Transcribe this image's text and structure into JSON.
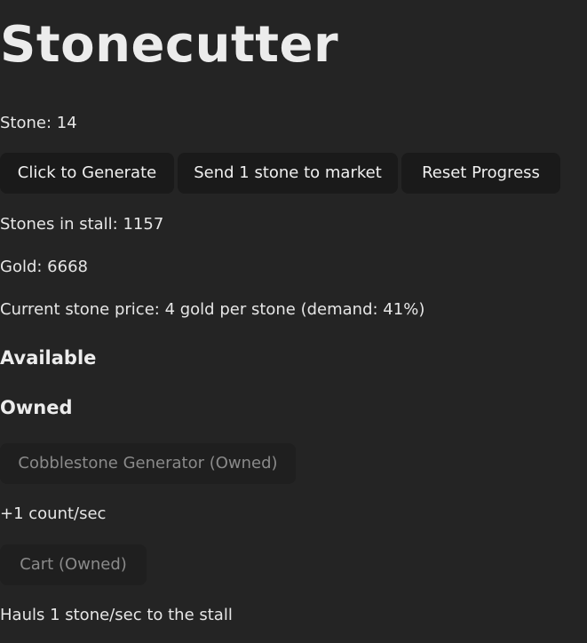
{
  "title": "Stonecutter",
  "stone_line": "Stone: 14",
  "buttons": {
    "generate": "Click to Generate",
    "send": "Send 1 stone to market",
    "reset": "Reset Progress"
  },
  "stall_line": "Stones in stall: 1157",
  "gold_line": "Gold: 6668",
  "price_line": "Current stone price: 4 gold per stone (demand: 41%)",
  "sections": {
    "available": "Available",
    "owned": "Owned"
  },
  "owned_items": [
    {
      "label": "Cobblestone Generator (Owned)",
      "description": "+1 count/sec"
    },
    {
      "label": "Cart (Owned)",
      "description": "Hauls 1 stone/sec to the stall"
    }
  ]
}
